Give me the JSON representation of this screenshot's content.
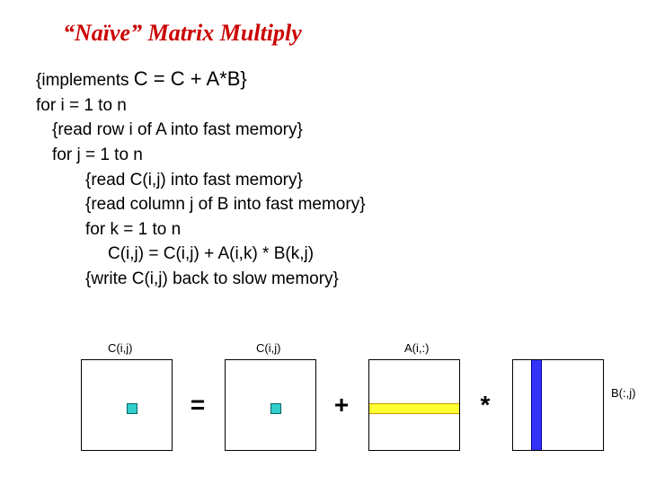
{
  "title": "“Naïve” Matrix Multiply",
  "code": {
    "l1a": "{implements ",
    "l1b": "C = C + A*B}",
    "l2": "for i = 1 to n",
    "l3": "{read row i of A into fast memory}",
    "l4": "for j = 1 to n",
    "l5": "{read C(i,j) into fast memory}",
    "l6": "{read column j of B into fast memory}",
    "l7": "for k = 1 to n",
    "l8": "C(i,j) = C(i,j) + A(i,k) * B(k,j)",
    "l9": "{write C(i,j) back to slow memory}"
  },
  "ops": {
    "eq": "=",
    "plus": "+",
    "times": "*"
  },
  "labels": {
    "c_left": "C(i,j)",
    "c_right": "C(i,j)",
    "a_row": "A(i,:)",
    "b_col": "B(:,j)"
  }
}
